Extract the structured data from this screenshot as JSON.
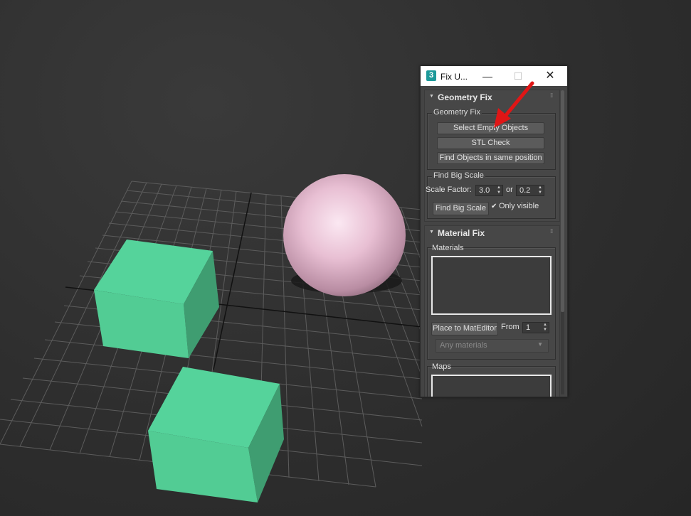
{
  "window": {
    "title": "Fix U...",
    "app_icon": "3",
    "minimize_icon": "—",
    "maximize_icon": "☐",
    "close_icon": "✕"
  },
  "geometry_rollout": {
    "title": "Geometry Fix",
    "group_geometry": {
      "label": "Geometry Fix",
      "select_empty_label": "Select Empty Objects",
      "stl_check_label": "STL Check",
      "find_same_pos_label": "Find Objects in same position"
    },
    "group_big_scale": {
      "label": "Find Big Scale",
      "scale_factor_label": "Scale Factor:",
      "scale_factor_value": "3.0",
      "or_label": "or",
      "second_value": "0.2",
      "find_button_label": "Find Big Scale",
      "only_visible_label": "Only visible",
      "only_visible_checked": true
    }
  },
  "material_rollout": {
    "title": "Material Fix",
    "materials_label": "Materials",
    "place_button_label": "Place to MatEditor",
    "from_label": "From",
    "from_value": "1",
    "filter_dropdown_value": "Any materials",
    "maps_label": "Maps"
  },
  "colors": {
    "box_color": "#52cc94",
    "sphere_color": "#e8bfd3",
    "arrow_color": "#e01616"
  }
}
